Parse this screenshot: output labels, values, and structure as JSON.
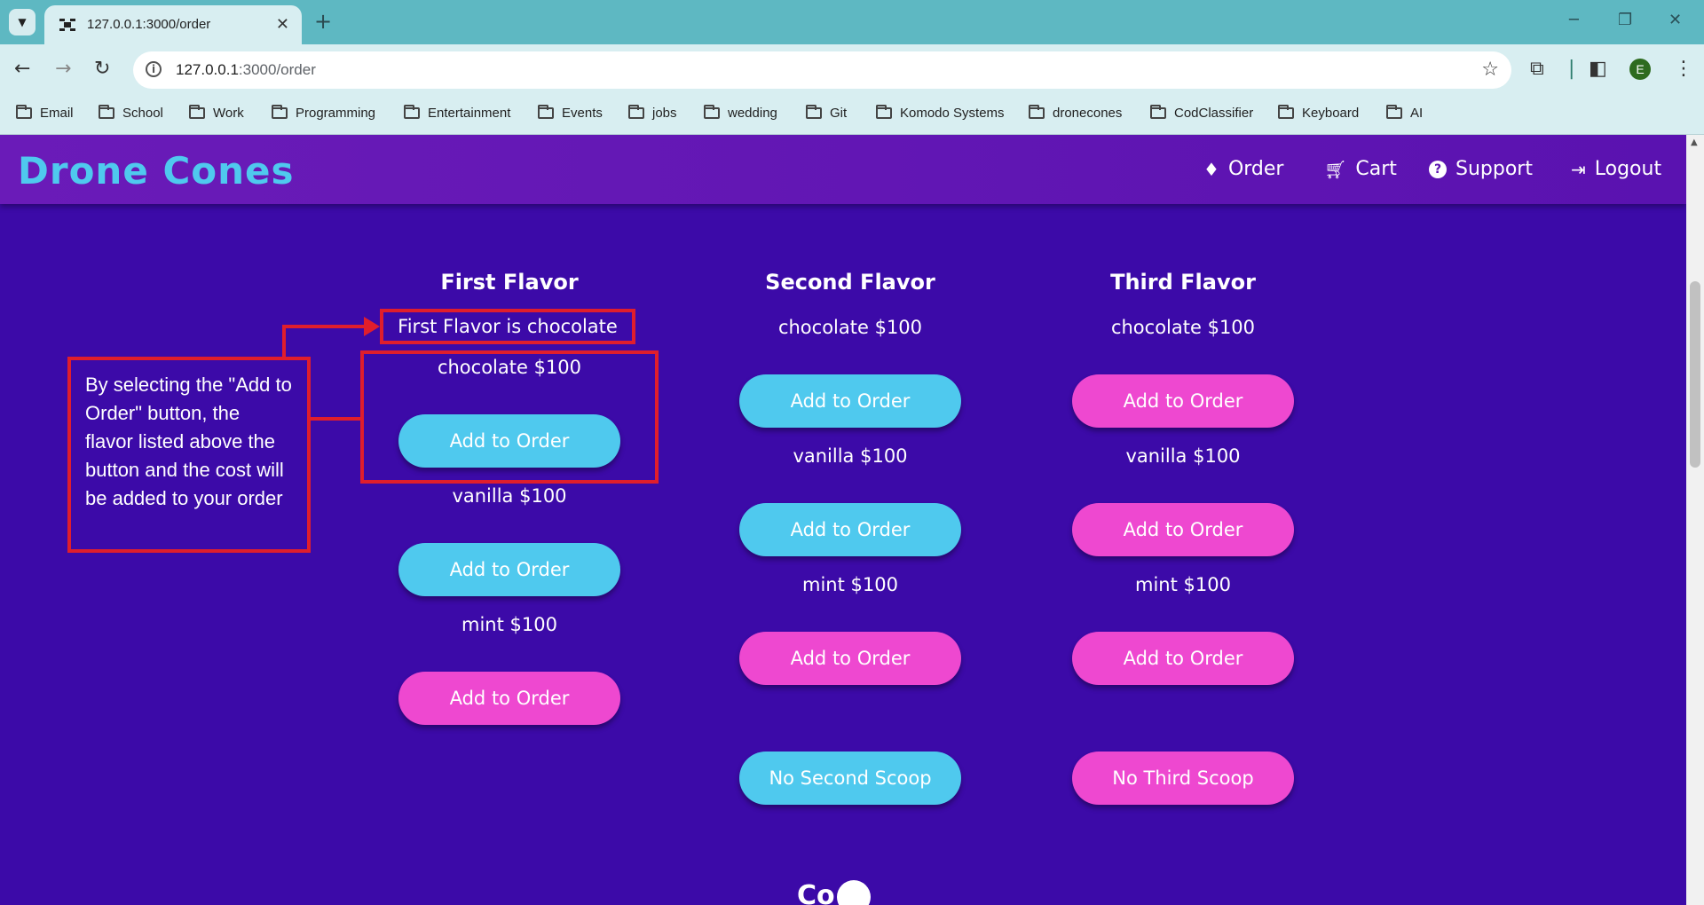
{
  "browser": {
    "tab_title": "127.0.0.1:3000/order",
    "url_host": "127.0.0.1",
    "url_rest": ":3000/order",
    "profile_initial": "E",
    "bookmarks": [
      "Email",
      "School",
      "Work",
      "Programming",
      "Entertainment",
      "Events",
      "jobs",
      "wedding",
      "Git",
      "Komodo Systems",
      "dronecones",
      "CodClassifier",
      "Keyboard",
      "AI"
    ]
  },
  "site": {
    "brand": "Drone Cones",
    "nav": {
      "order": "Order",
      "cart": "Cart",
      "support": "Support",
      "logout": "Logout"
    }
  },
  "columns": {
    "first": {
      "title": "First Flavor",
      "selected": "First Flavor is chocolate",
      "flavors": [
        "chocolate $100",
        "vanilla $100",
        "mint $100"
      ],
      "button": "Add to Order"
    },
    "second": {
      "title": "Second Flavor",
      "flavors": [
        "chocolate $100",
        "vanilla $100",
        "mint $100"
      ],
      "button": "Add to Order",
      "skip": "No Second Scoop"
    },
    "third": {
      "title": "Third Flavor",
      "flavors": [
        "chocolate $100",
        "vanilla $100",
        "mint $100"
      ],
      "button": "Add to Order",
      "skip": "No Third Scoop"
    }
  },
  "annotation": {
    "text": "By selecting the \"Add to Order\" button, the flavor listed above the button and the cost will be added to your order"
  },
  "footer": {
    "logo_text": "Co   s"
  },
  "colors": {
    "page_bg": "#3c0aa8",
    "header_bg": "#6a1bb8",
    "brand": "#4fc9ee",
    "button_blue": "#4fc9ee",
    "button_pink": "#ee48d0",
    "annotation_red": "#e01e2c"
  }
}
